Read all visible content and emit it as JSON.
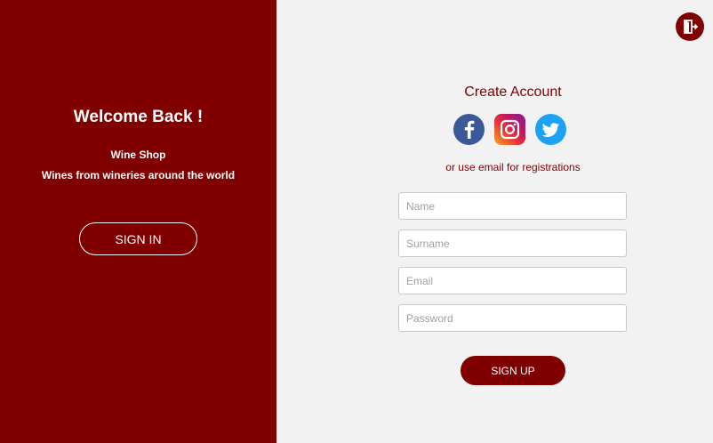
{
  "welcome_panel": {
    "title": "Welcome Back !",
    "shop_name": "Wine Shop",
    "tagline": "Wines from wineries around the world",
    "signin_label": "SIGN IN"
  },
  "form": {
    "title": "Create Account",
    "social": [
      "facebook-icon",
      "instagram-icon",
      "twitter-icon"
    ],
    "alt_text": "or use email for registrations",
    "name_placeholder": "Name",
    "surname_placeholder": "Surname",
    "email_placeholder": "Email",
    "password_placeholder": "Password",
    "signup_label": "SIGN UP"
  },
  "colors": {
    "accent": "#800000",
    "background": "#f2f2f2"
  }
}
